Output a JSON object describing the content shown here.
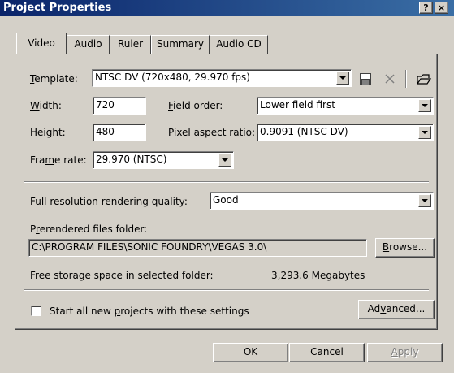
{
  "window": {
    "title": "Project Properties",
    "help_label": "?",
    "close_label": "×"
  },
  "tabs": [
    {
      "label": "Video",
      "active": true
    },
    {
      "label": "Audio",
      "active": false
    },
    {
      "label": "Ruler",
      "active": false
    },
    {
      "label": "Summary",
      "active": false
    },
    {
      "label": "Audio CD",
      "active": false
    }
  ],
  "template": {
    "label_u": "T",
    "label_rest": "emplate:",
    "value": "NTSC DV (720x480, 29.970 fps)",
    "icons": [
      "save-icon",
      "delete-icon",
      "open-folder-icon"
    ]
  },
  "width": {
    "label_u": "W",
    "label_rest": "idth:",
    "value": "720"
  },
  "height": {
    "label_u": "H",
    "label_rest": "eight:",
    "value": "480"
  },
  "field_order": {
    "label_u": "F",
    "label_rest": "ield order:",
    "value": "Lower field first"
  },
  "pixel_aspect": {
    "label_pre": "Pi",
    "label_u": "x",
    "label_rest": "el aspect ratio:",
    "value": "0.9091 (NTSC DV)"
  },
  "frame_rate": {
    "label_pre": "Fra",
    "label_u": "m",
    "label_rest": "e rate:",
    "value": "29.970 (NTSC)"
  },
  "render_quality": {
    "label_pre": "Full resolution ",
    "label_u": "r",
    "label_rest": "endering quality:",
    "value": "Good"
  },
  "prerender": {
    "label_pre": "P",
    "label_u": "r",
    "label_rest": "erendered files folder:",
    "value": "C:\\PROGRAM FILES\\SONIC FOUNDRY\\VEGAS 3.0\\",
    "browse_u": "B",
    "browse_rest": "rowse..."
  },
  "storage": {
    "label": "Free storage space in selected folder:",
    "value": "3,293.6 Megabytes"
  },
  "start_new": {
    "label_pre": "Start all new ",
    "label_u": "p",
    "label_rest": "rojects with these settings",
    "checked": false
  },
  "advanced": {
    "label_pre": "Ad",
    "label_u": "v",
    "label_rest": "anced..."
  },
  "buttons": {
    "ok": "OK",
    "cancel": "Cancel",
    "apply_u": "A",
    "apply_rest": "pply"
  }
}
